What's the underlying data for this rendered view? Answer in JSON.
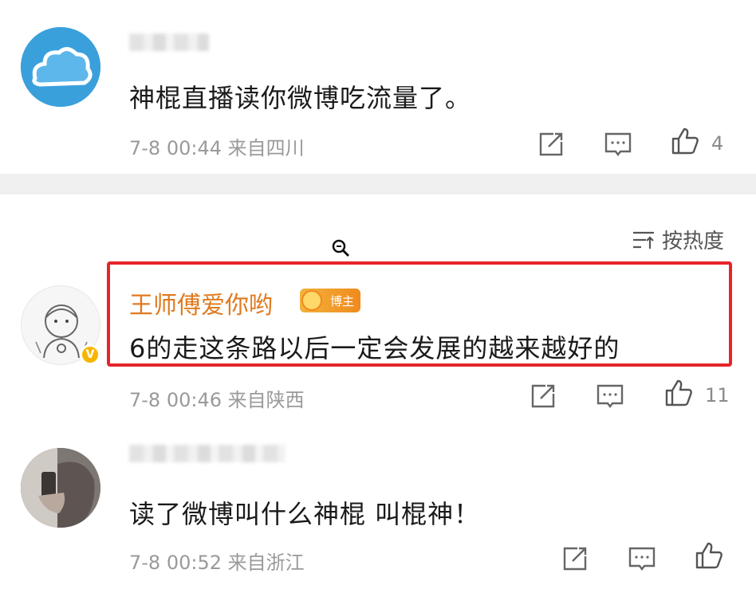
{
  "comments": [
    {
      "text": "神棍直播读你微博吃流量了。",
      "time": "7-8 00:44",
      "source": "来自四川",
      "likes": "4"
    },
    {
      "username": "王师傅爱你哟",
      "badge": "博主",
      "text": "6的走这条路以后一定会发展的越来越好的",
      "time": "7-8 00:46",
      "source": "来自陕西",
      "likes": "11"
    },
    {
      "text": "读了微博叫什么神棍 叫棍神！",
      "time": "7-8 00:52",
      "source": "来自浙江",
      "likes": ""
    }
  ],
  "sort": {
    "label": "按热度"
  },
  "colors": {
    "highlight": "#e5242b",
    "username": "#e07a1f",
    "meta": "#9a9a9a"
  }
}
